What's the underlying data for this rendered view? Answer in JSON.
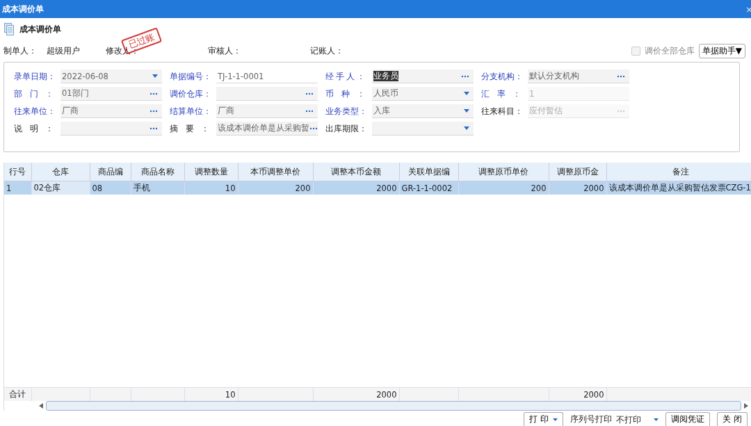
{
  "window": {
    "title": "成本调价单",
    "close": "×"
  },
  "header": {
    "title": "成本调价单"
  },
  "info": [
    {
      "label": "制单人：",
      "value": "超级用户"
    },
    {
      "label": "修改人："
    },
    {
      "label": "审核人："
    },
    {
      "label": "记账人："
    }
  ],
  "stamp": "已过账",
  "options": {
    "checkbox": {
      "label": "调价全部仓库",
      "checked": false,
      "disabled": true
    },
    "helper_button": "单据助手▼"
  },
  "form": [
    {
      "label": "录单日期：",
      "value": "2022-06-08",
      "kind": "date",
      "required": true,
      "disabled": false,
      "highlighted": false
    },
    {
      "label": "单据编号：",
      "value": "TJ-1-1-0001",
      "kind": "text",
      "required": true,
      "disabled": false,
      "highlighted": false
    },
    {
      "label": "经手人：",
      "value": "业务员",
      "kind": "lookup",
      "required": true,
      "disabled": false,
      "highlighted": true
    },
    {
      "label": "分支机构：",
      "value": "默认分支机构",
      "kind": "lookup",
      "required": true,
      "disabled": false,
      "highlighted": false
    },
    {
      "label": "部门：",
      "value": "01部门",
      "kind": "lookup",
      "required": true,
      "disabled": false,
      "highlighted": false
    },
    {
      "label": "调价仓库：",
      "kind": "lookup",
      "required": true,
      "disabled": false
    },
    {
      "label": "币种：",
      "value": "人民币",
      "kind": "select",
      "required": true,
      "disabled": false,
      "highlighted": false
    },
    {
      "label": "汇率：",
      "value": "1",
      "kind": "text",
      "required": true,
      "disabled": true,
      "highlighted": false
    },
    {
      "label": "往来单位：",
      "value": "厂商",
      "kind": "lookup",
      "required": true,
      "disabled": false,
      "highlighted": false
    },
    {
      "label": "结算单位：",
      "value": "厂商",
      "kind": "lookup",
      "required": true,
      "disabled": false,
      "highlighted": false
    },
    {
      "label": "业务类型：",
      "value": "入库",
      "kind": "select",
      "required": true,
      "disabled": false,
      "highlighted": false
    },
    {
      "label": "往来科目：",
      "value": "应付暂估",
      "kind": "lookup",
      "required": false,
      "disabled": true,
      "highlighted": false
    },
    {
      "label": "说明：",
      "kind": "lookup",
      "required": false,
      "disabled": false
    },
    {
      "label": "摘要：",
      "value": "该成本调价单是从采购暂",
      "kind": "lookup",
      "required": false,
      "disabled": false,
      "highlighted": false
    },
    {
      "label": "出库期限：",
      "kind": "select",
      "required": false,
      "disabled": false
    }
  ],
  "table": {
    "columns": [
      {
        "label": "行号",
        "kind": "text"
      },
      {
        "label": "仓库",
        "kind": "text"
      },
      {
        "label": "商品编",
        "kind": "text"
      },
      {
        "label": "商品名称",
        "kind": "text"
      },
      {
        "label": "调整数量",
        "kind": "number",
        "total": "10"
      },
      {
        "label": "本币调整单价",
        "kind": "number"
      },
      {
        "label": "调整本币金额",
        "kind": "number",
        "total": "2000"
      },
      {
        "label": "关联单据编",
        "kind": "text"
      },
      {
        "label": "调整原币单价",
        "kind": "number"
      },
      {
        "label": "调整原币金",
        "kind": "number",
        "total": "2000"
      },
      {
        "label": "备注",
        "kind": "text"
      }
    ],
    "rows": [
      {
        "selected": true,
        "cells": [
          "1",
          "02仓库",
          "08",
          "手机",
          "10",
          "200",
          "2000",
          "GR-1-1-0002",
          "200",
          "2000",
          "该成本调价单是从采购暂估发票CZG-1"
        ]
      }
    ],
    "totals_label": "合计"
  },
  "footer": {
    "print_button": "打 印",
    "serial_label": "序列号打印",
    "serial_select": "不打印",
    "voucher_button": "调阅凭证",
    "close_button": "关 闭"
  }
}
